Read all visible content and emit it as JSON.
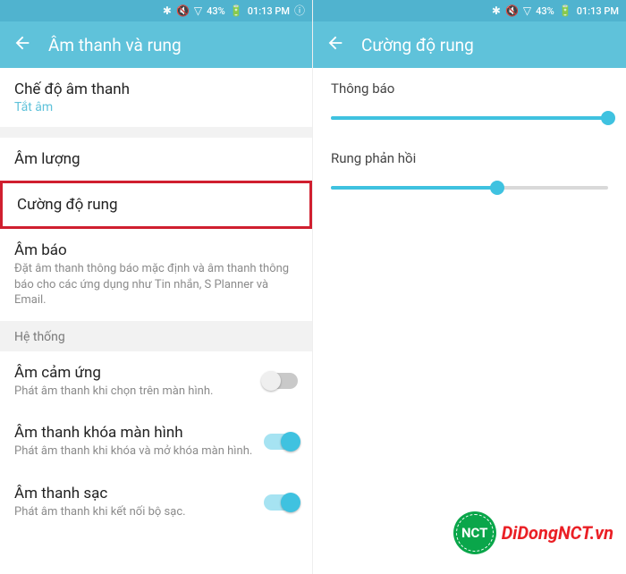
{
  "status": {
    "battery": "43%",
    "time": "01:13 PM"
  },
  "left": {
    "header_title": "Âm thanh và rung",
    "sound_mode": {
      "title": "Chế độ âm thanh",
      "value": "Tắt âm"
    },
    "volume_title": "Âm lượng",
    "vibration_intensity_title": "Cường độ rung",
    "notification_sound": {
      "title": "Âm báo",
      "desc": "Đặt âm thanh thông báo mặc định và âm thanh thông báo cho các ứng dụng như Tin nhắn, S Planner và Email."
    },
    "section_system": "Hệ thống",
    "touch_sounds": {
      "title": "Âm cảm ứng",
      "desc": "Phát âm thanh khi chọn trên màn hình."
    },
    "screen_lock": {
      "title": "Âm thanh khóa màn hình",
      "desc": "Phát âm thanh khi khóa và mở khóa màn hình."
    },
    "charging": {
      "title": "Âm thanh sạc",
      "desc": "Phát âm thanh khi kết nối bộ sạc."
    }
  },
  "right": {
    "header_title": "Cường độ rung",
    "slider1_label": "Thông báo",
    "slider1_value_pct": 100,
    "slider2_label": "Rung phản hồi",
    "slider2_value_pct": 60
  },
  "watermark": {
    "logo_text": "NCT",
    "brand": "DiDongNCT.vn"
  }
}
